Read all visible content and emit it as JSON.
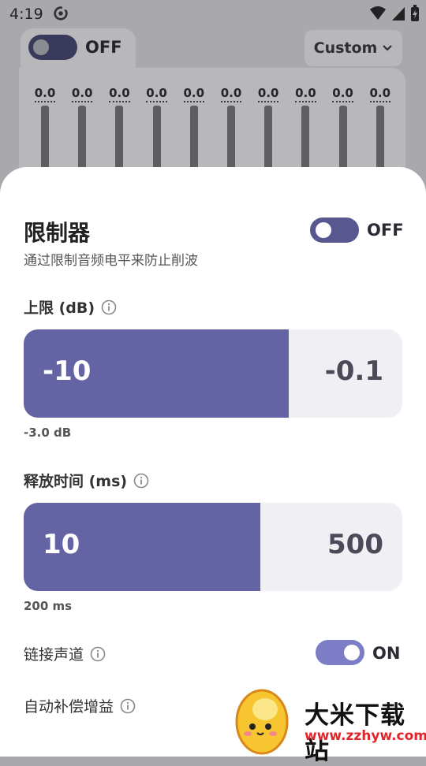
{
  "status_bar": {
    "time": "4:19"
  },
  "background": {
    "eq_switch_label": "OFF",
    "preset_label": "Custom",
    "bands": [
      "0.0",
      "0.0",
      "0.0",
      "0.0",
      "0.0",
      "0.0",
      "0.0",
      "0.0",
      "0.0",
      "0.0"
    ]
  },
  "limiter": {
    "title": "限制器",
    "subtitle": "通过限制音频电平来防止削波",
    "toggle_label": "OFF",
    "toggle_on": false
  },
  "threshold": {
    "label": "上限 (dB)",
    "min": "-10",
    "max": "-0.1",
    "current": "-3.0 dB",
    "fill_fraction": 0.7
  },
  "release": {
    "label": "释放时间 (ms)",
    "min": "10",
    "max": "500",
    "current": "200 ms",
    "fill_fraction": 0.625
  },
  "link_channels": {
    "label": "链接声道",
    "toggle_label": "ON",
    "toggle_on": true
  },
  "auto_gain": {
    "label": "自动补偿增益"
  },
  "watermark": {
    "name": "大米下载站",
    "url": "www.zzhyw.com"
  },
  "colors": {
    "accent": "#6463a3",
    "toggle_on": "#7d7cc6",
    "toggle_off": "#58578f"
  }
}
